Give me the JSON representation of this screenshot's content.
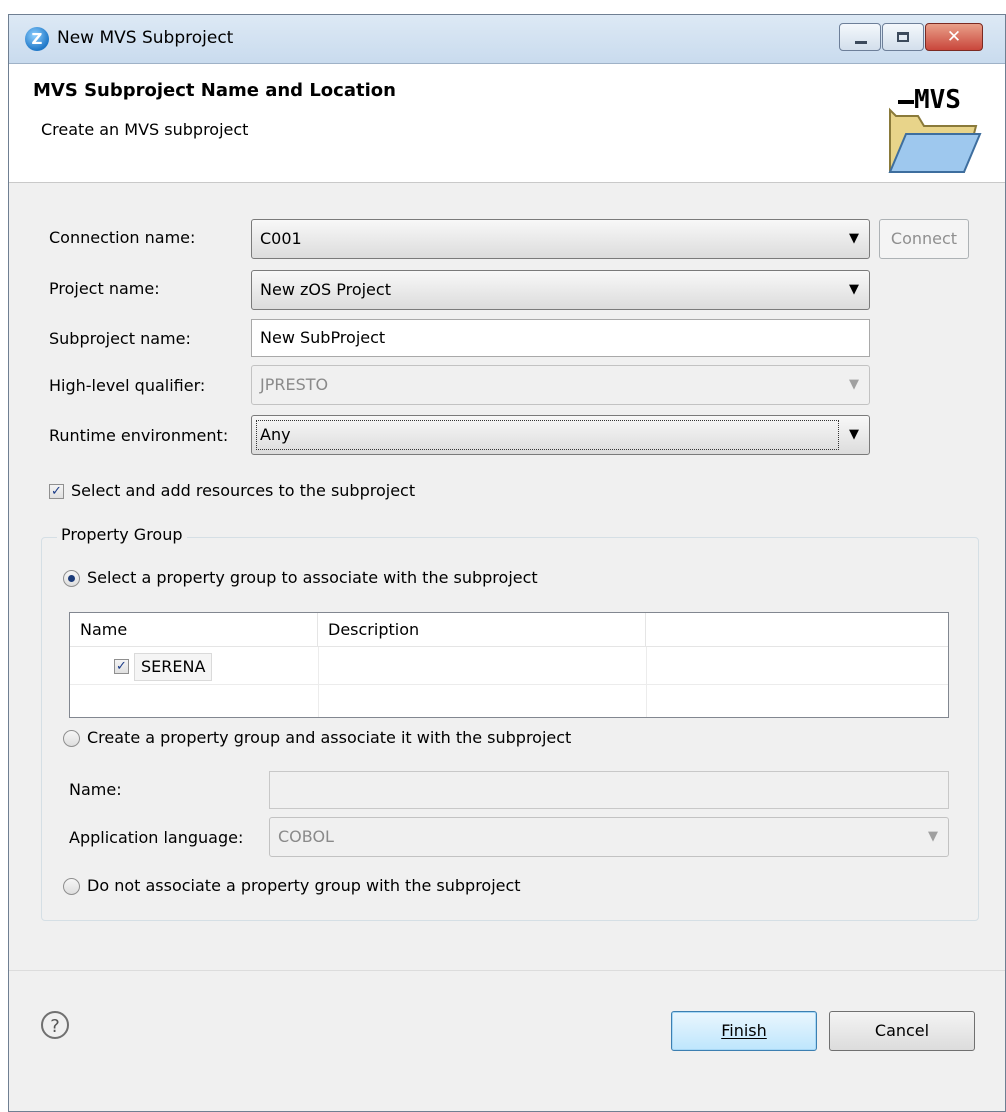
{
  "window": {
    "title": "New MVS Subproject",
    "close_glyph": "✕"
  },
  "banner": {
    "title": "MVS Subproject Name and Location",
    "subtitle": "Create an MVS subproject",
    "logo_text": "MVS"
  },
  "form": {
    "connection_label": "Connection name:",
    "connection_value": "C001",
    "connect_button": "Connect",
    "project_label": "Project name:",
    "project_value": "New zOS Project",
    "subproject_label": "Subproject name:",
    "subproject_value": "New SubProject",
    "hlq_label": "High-level qualifier:",
    "hlq_value": "JPRESTO",
    "runtime_label": "Runtime environment:",
    "runtime_value": "Any",
    "add_resources_label": "Select and add resources to the subproject",
    "add_resources_checked": true
  },
  "property_group": {
    "title": "Property Group",
    "option_select": "Select a property group to associate with the subproject",
    "option_create": "Create a property group and associate it with the subproject",
    "option_none": "Do not associate a property group with the subproject",
    "selected_option": "select",
    "table": {
      "columns": [
        "Name",
        "Description"
      ],
      "rows": [
        {
          "name": "SERENA",
          "description": "",
          "checked": true
        }
      ]
    },
    "new_name_label": "Name:",
    "new_name_value": "",
    "language_label": "Application language:",
    "language_value": "COBOL"
  },
  "footer": {
    "help_glyph": "?",
    "finish_button": "Finish",
    "cancel_button": "Cancel"
  }
}
